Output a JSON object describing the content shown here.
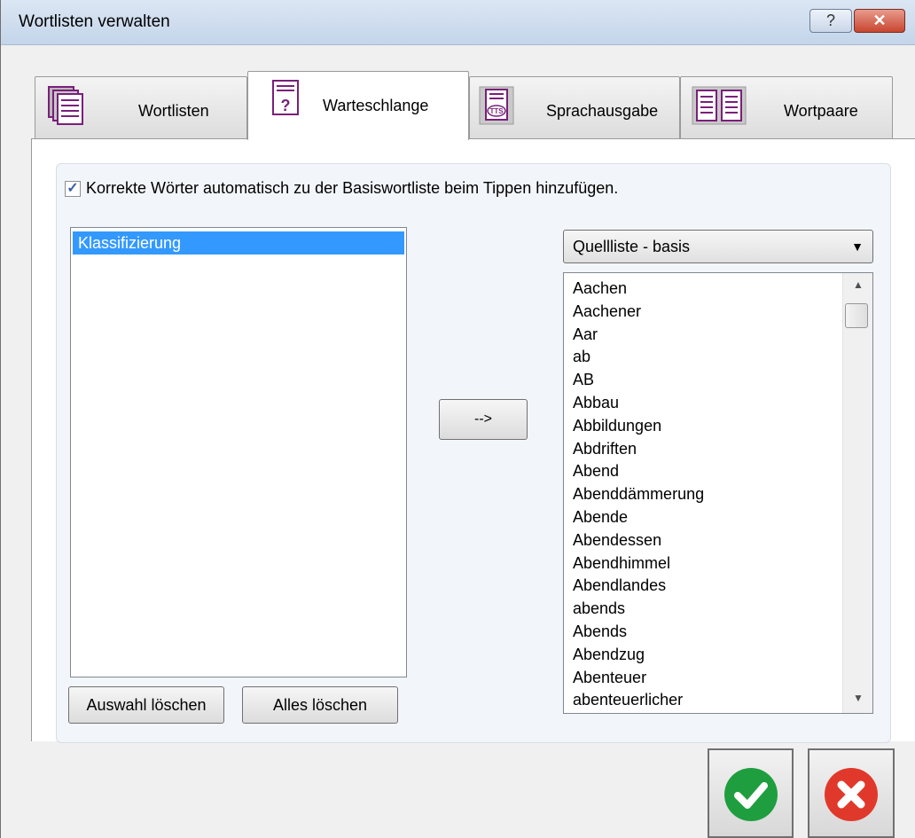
{
  "window": {
    "title": "Wortlisten verwalten",
    "help_symbol": "?",
    "close_symbol": "✕"
  },
  "tabs": [
    {
      "label": "Wortlisten",
      "icon": "list-document-icon"
    },
    {
      "label": "Warteschlange",
      "icon": "question-document-icon"
    },
    {
      "label": "Sprachausgabe",
      "icon": "tts-document-icon"
    },
    {
      "label": "Wortpaare",
      "icon": "word-pairs-icon"
    }
  ],
  "active_tab": "Warteschlange",
  "queue": {
    "auto_add_checked": true,
    "auto_add_label": "Korrekte Wörter automatisch zu der Basiswortliste beim Tippen hinzufügen.",
    "items": [
      "Klassifizierung"
    ],
    "selected_item": "Klassifizierung",
    "clear_selection_label": "Auswahl löschen",
    "clear_all_label": "Alles löschen",
    "transfer_label": "-->"
  },
  "source": {
    "selected": "Quellliste - basis",
    "words": [
      "Aachen",
      "Aachener",
      "Aar",
      "ab",
      "AB",
      "Abbau",
      "Abbildungen",
      "Abdriften",
      "Abend",
      "Abenddämmerung",
      "Abende",
      "Abendessen",
      "Abendhimmel",
      "Abendlandes",
      "abends",
      "Abends",
      "Abendzug",
      "Abenteuer",
      "abenteuerlicher"
    ]
  },
  "colors": {
    "selection": "#3399ff",
    "ok_green": "#1f9e3f",
    "cancel_red": "#e0392b",
    "icon_purple": "#7a1f7a"
  }
}
